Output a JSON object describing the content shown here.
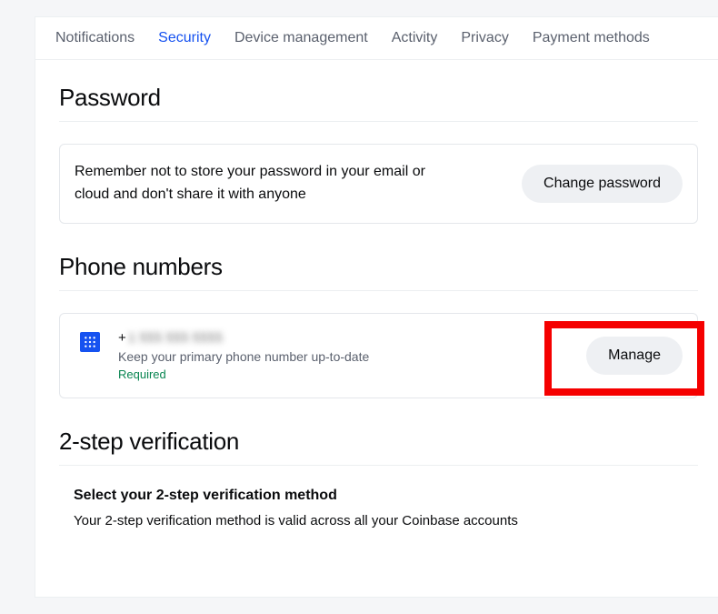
{
  "tabs": [
    {
      "label": "Notifications",
      "active": false
    },
    {
      "label": "Security",
      "active": true
    },
    {
      "label": "Device management",
      "active": false
    },
    {
      "label": "Activity",
      "active": false
    },
    {
      "label": "Privacy",
      "active": false
    },
    {
      "label": "Payment methods",
      "active": false
    }
  ],
  "password": {
    "title": "Password",
    "body": "Remember not to store your password in your email or cloud and don't share it with anyone",
    "button": "Change password"
  },
  "phone": {
    "title": "Phone numbers",
    "number_prefix": "+",
    "number_masked": "1 555 555 5555",
    "sub": "Keep your primary phone number up-to-date",
    "required": "Required",
    "button": "Manage"
  },
  "two_step": {
    "title": "2-step verification",
    "heading": "Select your 2-step verification method",
    "sub": "Your 2-step verification method is valid across all your Coinbase accounts"
  }
}
